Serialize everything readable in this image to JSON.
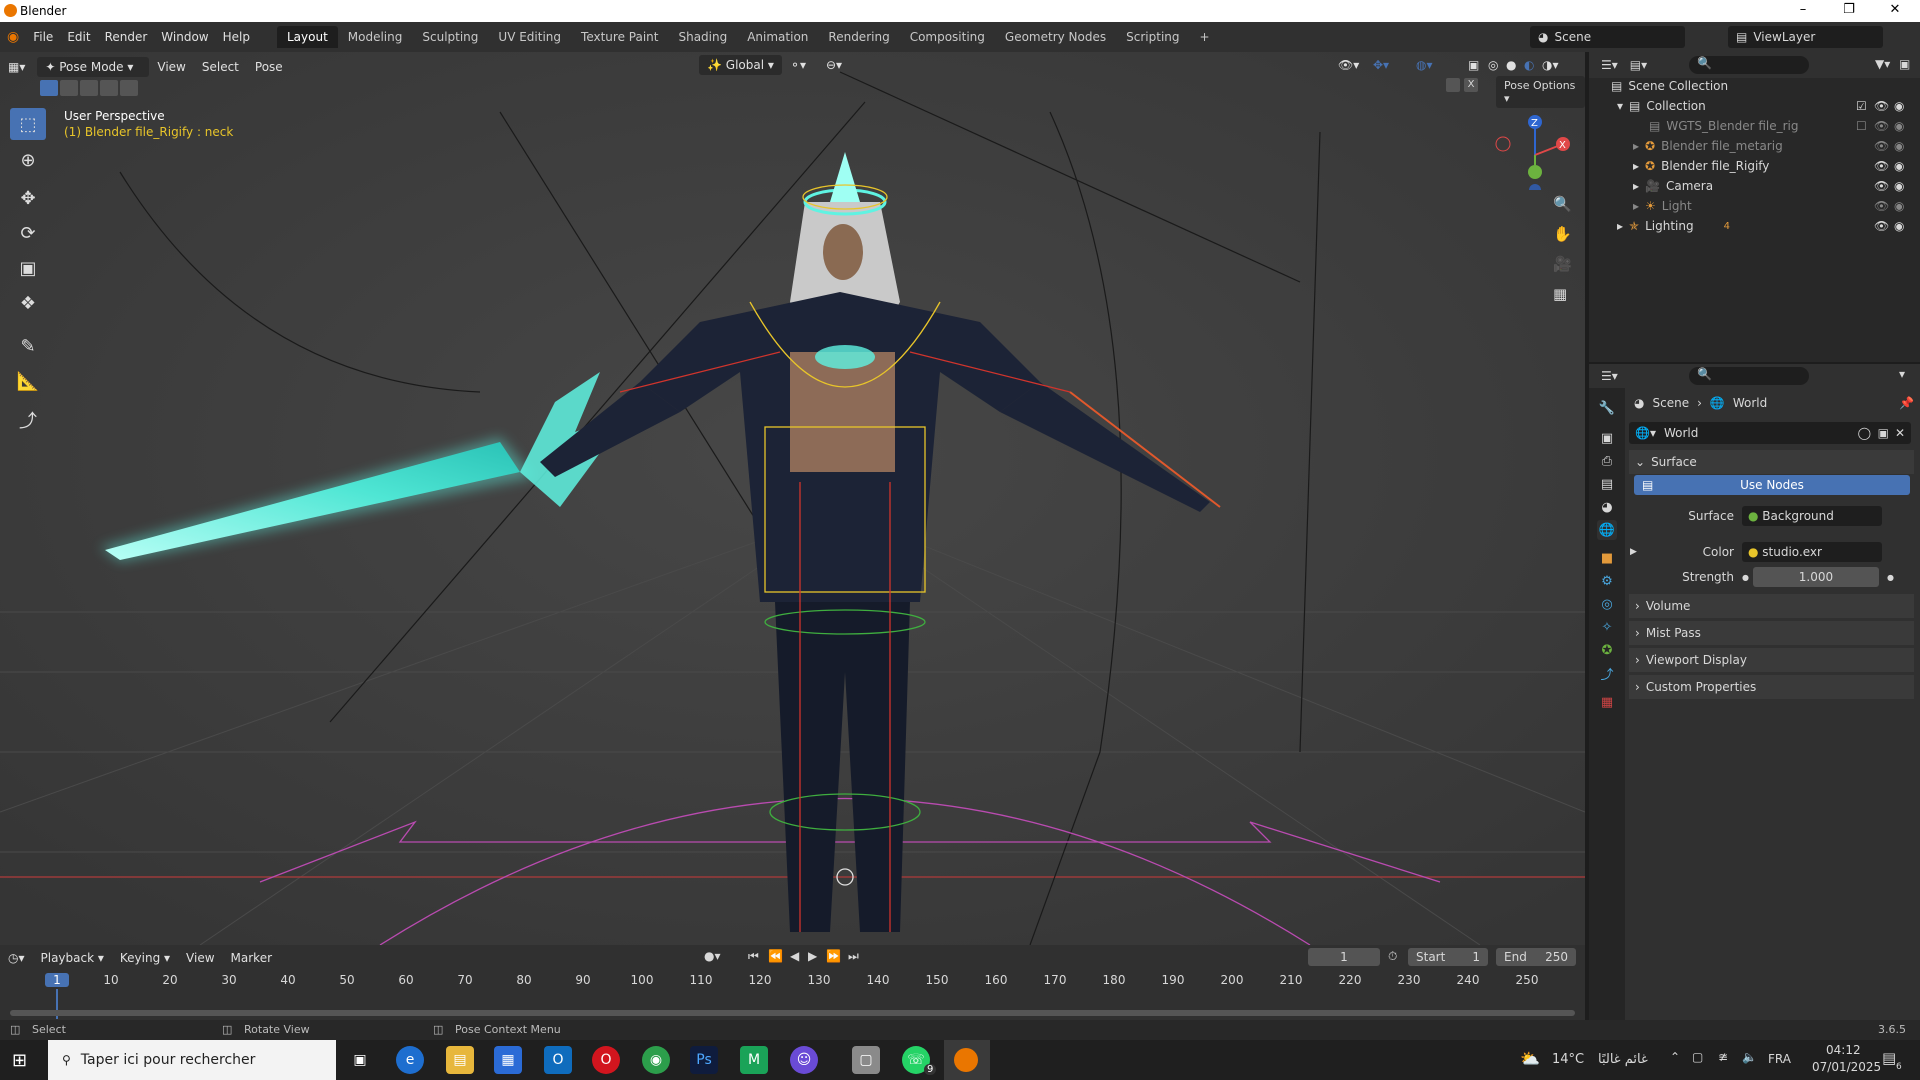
{
  "window": {
    "title": "Blender"
  },
  "menu": {
    "file": "File",
    "edit": "Edit",
    "render": "Render",
    "window": "Window",
    "help": "Help"
  },
  "workspaces": [
    "Layout",
    "Modeling",
    "Sculpting",
    "UV Editing",
    "Texture Paint",
    "Shading",
    "Animation",
    "Rendering",
    "Compositing",
    "Geometry Nodes",
    "Scripting"
  ],
  "scene_selector": {
    "scene": "Scene",
    "view_layer": "ViewLayer"
  },
  "viewport": {
    "mode": "Pose Mode",
    "view": "View",
    "select": "Select",
    "pose": "Pose",
    "orientation": "Global",
    "pose_options": "Pose Options",
    "perspective_label": "User Perspective",
    "object_label": "(1) Blender file_Rigify : neck",
    "gizmo": {
      "z": "Z",
      "x": "X"
    }
  },
  "outliner": {
    "rows": [
      {
        "label": "Scene Collection"
      },
      {
        "label": "Collection"
      },
      {
        "label": "WGTS_Blender file_rig"
      },
      {
        "label": "Blender file_metarig"
      },
      {
        "label": "Blender file_Rigify"
      },
      {
        "label": "Camera"
      },
      {
        "label": "Light"
      },
      {
        "label": "Lighting",
        "badge": "4"
      }
    ]
  },
  "properties": {
    "breadcrumb_scene": "Scene",
    "breadcrumb_world": "World",
    "world_name": "World",
    "section_surface": "Surface",
    "use_nodes": "Use Nodes",
    "surface_label": "Surface",
    "surface_value": "Background",
    "color_label": "Color",
    "color_value": "studio.exr",
    "strength_label": "Strength",
    "strength_value": "1.000",
    "volume": "Volume",
    "mist_pass": "Mist Pass",
    "viewport_display": "Viewport Display",
    "custom_properties": "Custom Properties"
  },
  "timeline": {
    "playback": "Playback",
    "keying": "Keying",
    "view": "View",
    "marker": "Marker",
    "current_frame": "1",
    "start_label": "Start",
    "start_value": "1",
    "end_label": "End",
    "end_value": "250",
    "ticks": [
      "1",
      "10",
      "20",
      "30",
      "40",
      "50",
      "60",
      "70",
      "80",
      "90",
      "100",
      "110",
      "120",
      "130",
      "140",
      "150",
      "160",
      "170",
      "180",
      "190",
      "200",
      "210",
      "220",
      "230",
      "240",
      "250"
    ]
  },
  "statusbar": {
    "select": "Select",
    "rotate_view": "Rotate View",
    "pose_context_menu": "Pose Context Menu",
    "version": "3.6.5"
  },
  "taskbar": {
    "search_placeholder": "Taper ici pour rechercher",
    "weather": "14°C",
    "weather_desc": "غائم غالبًا",
    "lang": "FRA",
    "time": "04:12",
    "date": "07/01/2025",
    "whatsapp_badge": "9",
    "notif_badge": "6"
  },
  "colors": {
    "accent": "#4772b3",
    "selection": "#e8c52a",
    "glow": "#5ff3e2",
    "blender_orange": "#ea7600"
  }
}
